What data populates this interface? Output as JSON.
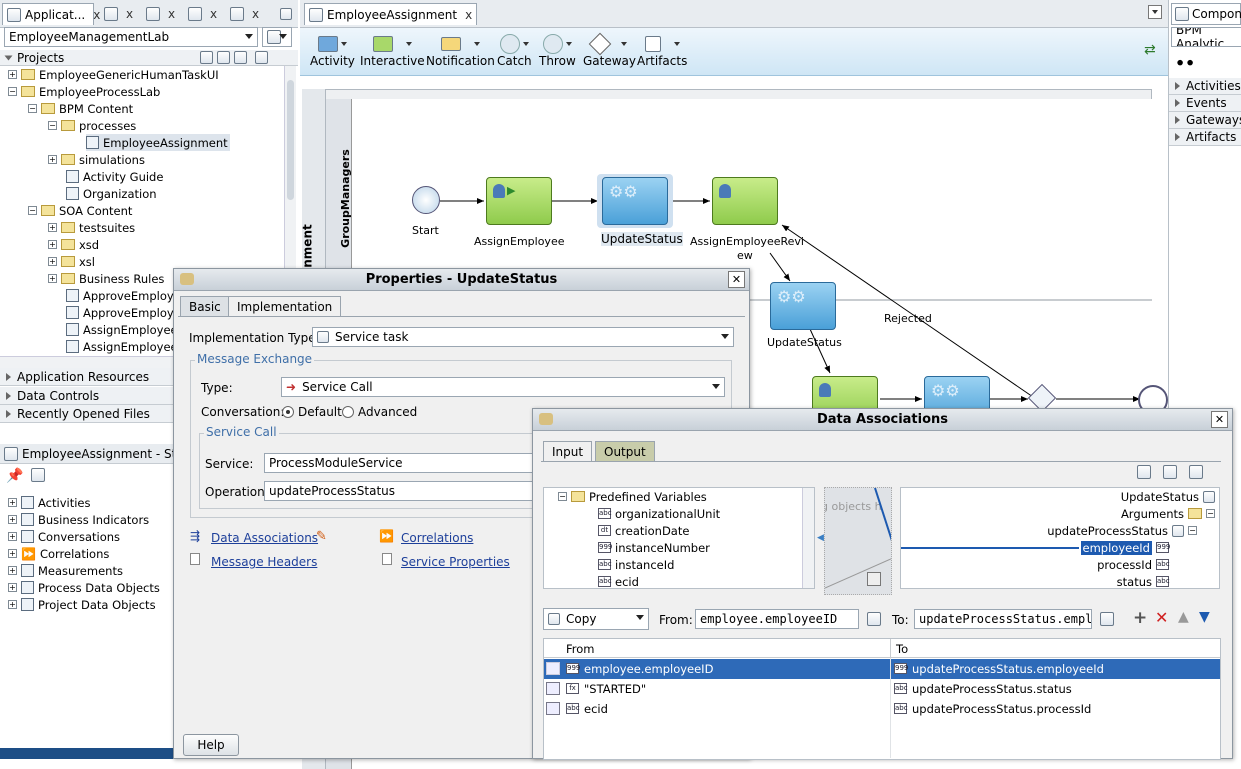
{
  "left_tabs": {
    "app_tab": "Applicat..."
  },
  "app_selector": "EmployeeManagementLab",
  "projects": {
    "title": "Projects",
    "items": [
      {
        "label": "EmployeeGenericHumanTaskUI"
      },
      {
        "label": "EmployeeProcessLab"
      },
      {
        "label": "BPM Content"
      },
      {
        "label": "processes"
      },
      {
        "label": "EmployeeAssignment"
      },
      {
        "label": "simulations"
      },
      {
        "label": "Activity Guide"
      },
      {
        "label": "Organization"
      },
      {
        "label": "SOA Content"
      },
      {
        "label": "testsuites"
      },
      {
        "label": "xsd"
      },
      {
        "label": "xsl"
      },
      {
        "label": "Business Rules"
      },
      {
        "label": "ApproveEmploy"
      },
      {
        "label": "ApproveEmploy"
      },
      {
        "label": "AssignEmployee"
      },
      {
        "label": "AssignEmployee"
      }
    ]
  },
  "sections": [
    "Application Resources",
    "Data Controls",
    "Recently Opened Files"
  ],
  "structure": {
    "title": "EmployeeAssignment - Stru",
    "items": [
      "Activities",
      "Business Indicators",
      "Conversations",
      "Correlations",
      "Measurements",
      "Process Data Objects",
      "Project Data Objects"
    ]
  },
  "editor_tab": "EmployeeAssignment",
  "palette": [
    "Activity",
    "Interactive",
    "Notification",
    "Catch",
    "Throw",
    "Gateway",
    "Artifacts"
  ],
  "diagram": {
    "swimlane": "GroupManagers",
    "pool_fragment": "nment",
    "start": "Start",
    "assign": "AssignEmployee",
    "update": "UpdateStatus",
    "review_1": "AssignEmployeeRevi",
    "review_2": "ew",
    "update2": "UpdateStatus",
    "rejected": "Rejected"
  },
  "components": {
    "tab": "Compone",
    "selector": "BPM Analytic",
    "items": [
      "Activities",
      "Events",
      "Gateways",
      "Artifacts"
    ]
  },
  "properties": {
    "title": "Properties - UpdateStatus",
    "tabs": [
      "Basic",
      "Implementation"
    ],
    "impl_type_label": "Implementation Type:",
    "impl_type": "Service task",
    "msg_exchange": "Message Exchange",
    "type_label": "Type:",
    "type": "Service Call",
    "conversation_label": "Conversation:",
    "conv_default": "Default",
    "conv_advanced": "Advanced",
    "service_call": "Service Call",
    "service_label": "Service:",
    "service": "ProcessModuleService",
    "operation_label": "Operation:",
    "operation": "updateProcessStatus",
    "links": [
      "Data Associations",
      "Correlations",
      "Message Headers",
      "Service Properties"
    ],
    "help": "Help"
  },
  "data_assoc": {
    "title": "Data Associations",
    "tabs": [
      "Input",
      "Output"
    ],
    "left_tree": [
      "Predefined Variables",
      "organizationalUnit",
      "creationDate",
      "instanceNumber",
      "instanceId",
      "ecid"
    ],
    "drag_hint": "g objects h",
    "right_tree": [
      "UpdateStatus",
      "Arguments",
      "updateProcessStatus",
      "employeeId",
      "processId",
      "status"
    ],
    "copy": "Copy",
    "from_label": "From:",
    "from_value": "employee.employeeID",
    "to_label": "To:",
    "to_value": "updateProcessStatus.emplo",
    "col_from": "From",
    "col_to": "To",
    "rows": [
      {
        "from": "employee.employeeID",
        "to": "updateProcessStatus.employeeId"
      },
      {
        "from": "\"STARTED\"",
        "to": "updateProcessStatus.status"
      },
      {
        "from": "ecid",
        "to": "updateProcessStatus.processId"
      }
    ]
  }
}
